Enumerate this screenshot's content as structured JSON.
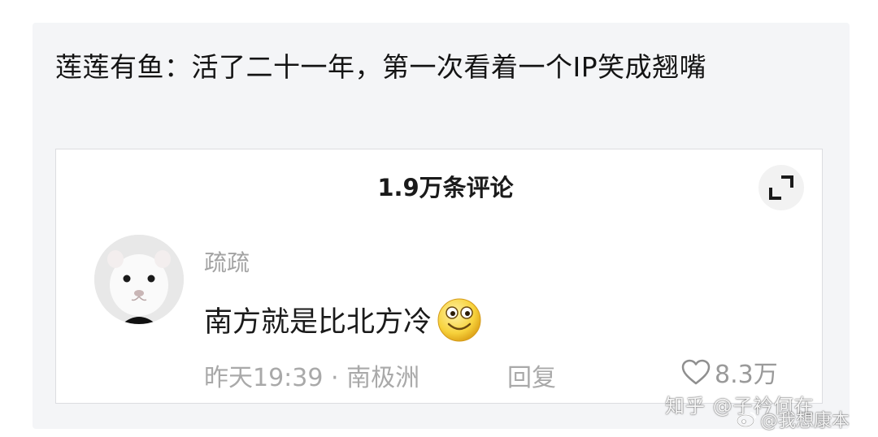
{
  "post": {
    "title": "莲莲有鱼：活了二十一年，第一次看着一个IP笑成翘嘴"
  },
  "comments_panel": {
    "header": "1.9万条评论",
    "comment": {
      "username": "疏疏",
      "text": "南方就是比北方冷",
      "emoji": "smile-emoji",
      "time": "昨天19:39",
      "separator": "·",
      "location": "南极洲",
      "reply_label": "回复",
      "likes": "8.3万"
    }
  },
  "watermarks": {
    "zhihu": "知乎 @子衿何在",
    "weibo": "@我想康本"
  },
  "colors": {
    "card_background": "#f4f5f7",
    "panel_border": "#dcdde0",
    "muted_text": "#a9a9a9",
    "primary_text": "#1a1a1a"
  }
}
